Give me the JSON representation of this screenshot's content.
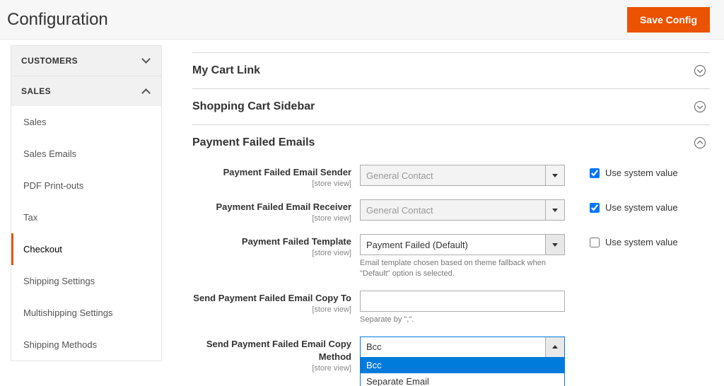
{
  "header": {
    "title": "Configuration",
    "save_label": "Save Config"
  },
  "sidebar": {
    "section_customers": {
      "label": "CUSTOMERS",
      "expanded": false
    },
    "section_sales": {
      "label": "SALES",
      "expanded": true,
      "items": [
        {
          "label": "Sales",
          "active": false
        },
        {
          "label": "Sales Emails",
          "active": false
        },
        {
          "label": "PDF Print-outs",
          "active": false
        },
        {
          "label": "Tax",
          "active": false
        },
        {
          "label": "Checkout",
          "active": true
        },
        {
          "label": "Shipping Settings",
          "active": false
        },
        {
          "label": "Multishipping Settings",
          "active": false
        },
        {
          "label": "Shipping Methods",
          "active": false
        }
      ]
    }
  },
  "sections": {
    "my_cart_link": {
      "title": "My Cart Link"
    },
    "shopping_cart_sidebar": {
      "title": "Shopping Cart Sidebar"
    },
    "payment_failed_emails": {
      "title": "Payment Failed Emails"
    }
  },
  "scope_label": "[store view]",
  "use_system_label": "Use system value",
  "fields": {
    "sender": {
      "label": "Payment Failed Email Sender",
      "value": "General Contact",
      "use_system": true
    },
    "receiver": {
      "label": "Payment Failed Email Receiver",
      "value": "General Contact",
      "use_system": true
    },
    "template": {
      "label": "Payment Failed Template",
      "value": "Payment Failed (Default)",
      "hint": "Email template chosen based on theme fallback when \"Default\" option is selected.",
      "use_system": false
    },
    "copy_to": {
      "label": "Send Payment Failed Email Copy To",
      "value": "",
      "hint": "Separate by \",\"."
    },
    "copy_method": {
      "label": "Send Payment Failed Email Copy Method",
      "value": "Bcc",
      "options": [
        "Bcc",
        "Separate Email"
      ],
      "selected_index": 0
    }
  }
}
